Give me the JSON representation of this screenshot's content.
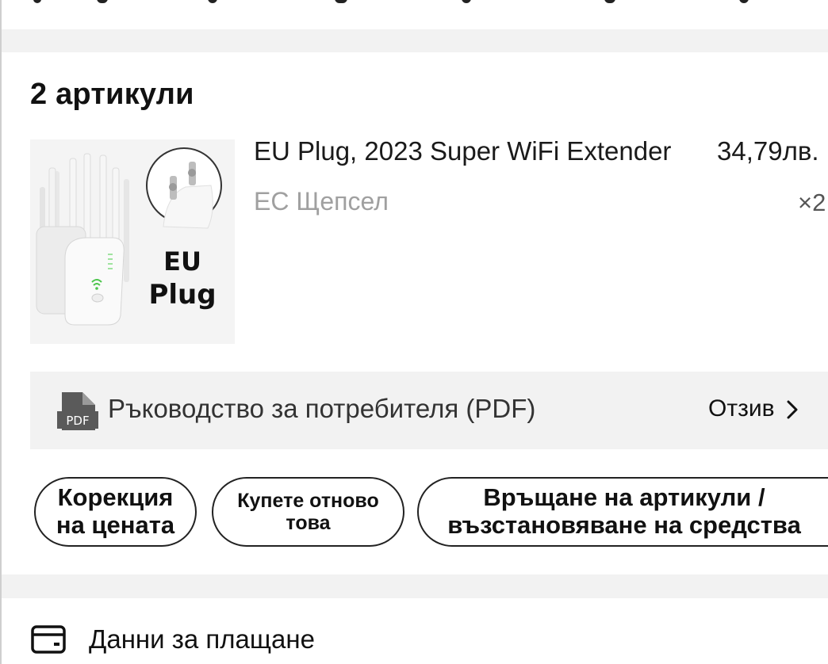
{
  "order_items": {
    "title": "2 артикули",
    "item": {
      "image_alt": "WiFi extender EU plug",
      "image_caption_line1": "EU",
      "image_caption_line2": "Plug",
      "name": "EU Plug, 2023 Super WiFi Extender",
      "price": "34,79лв.",
      "variant": "ЕС Щепсел",
      "quantity": "×2"
    },
    "manual": {
      "icon": "pdf-icon",
      "icon_text": "PDF",
      "label": "Ръководство за потребителя (PDF)",
      "review_label": "Отзив"
    },
    "actions": {
      "price_adjust_line1": "Корекция",
      "price_adjust_line2": "на цената",
      "buy_again_line1": "Купете отново",
      "buy_again_line2": "това",
      "return_line1": "Връщане на артикули /",
      "return_line2": "възстановяване на средства"
    }
  },
  "payment": {
    "icon": "card-icon",
    "label": "Данни за плащане"
  },
  "colors": {
    "band": "#f2f2f2",
    "muted_text": "#a0a0a0",
    "pdf_icon": "#555555"
  }
}
